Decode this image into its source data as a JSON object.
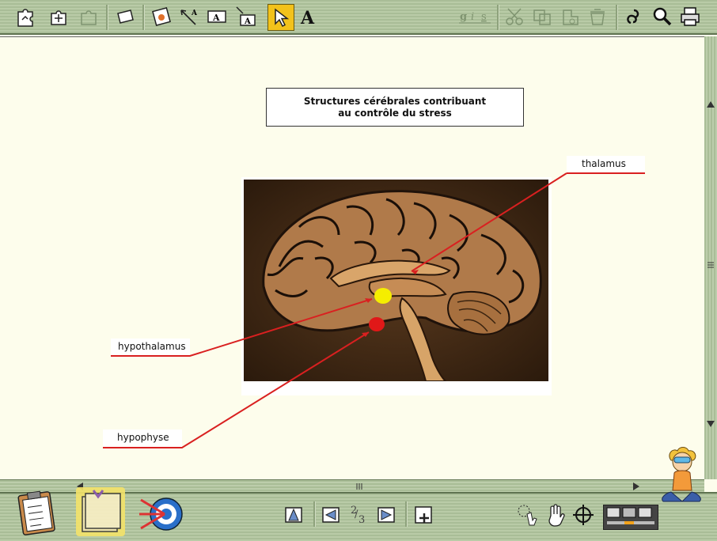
{
  "toolbar": {
    "left_tools": [
      "puzzle-icon",
      "puzzle-add-icon",
      "puzzle-disabled-icon",
      "eraser-icon",
      "picture-icon",
      "arrow-label-icon",
      "text-box-icon",
      "arrow-text-box-icon",
      "pointer-icon",
      "text-style-icon"
    ],
    "format_letters": [
      "g",
      "i",
      "s"
    ],
    "right_tools": [
      "scissors-icon",
      "copy-icon",
      "paste-icon",
      "trash-icon",
      "link-icon",
      "magnifier-icon",
      "printer-icon"
    ]
  },
  "slide": {
    "title_line1": "Structures cérébrales contribuant",
    "title_line2": "au contrôle du stress",
    "labels": {
      "thalamus": "thalamus",
      "hypothalamus": "hypothalamus",
      "hypophyse": "hypophyse"
    }
  },
  "bottom": {
    "page_current": "2",
    "page_total": "3"
  },
  "colors": {
    "toolbar_green": "#a9bd97",
    "canvas": "#fdfdec",
    "pointer_line": "#e02020",
    "hypothalamus_mark": "#f5ee00",
    "hypophyse_mark": "#e01818",
    "active_tool": "#f2c21b"
  }
}
